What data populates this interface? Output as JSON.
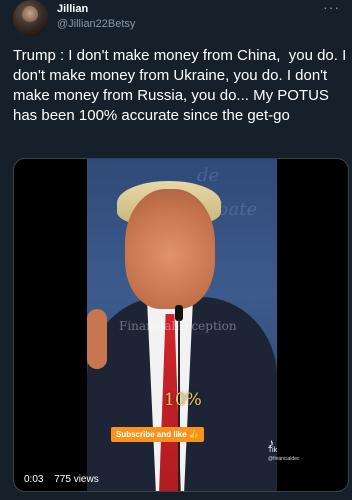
{
  "tweet": {
    "display_name": "Jillian",
    "handle": "@Jillian22Betsy",
    "more_icon": "ellipsis-icon",
    "text": "Trump : I don't make money from China,  you do. I don't make money from Ukraine, you do. I don't make money from Russia, you do... My POTUS has been 100% accurate since the get-go"
  },
  "video": {
    "watermark": "FinancialReception",
    "overlay_percent": "10%",
    "subscribe_label": "Subscribe and like 👍",
    "tiktok_label": "Tik",
    "tiktok_user": "@financialdec",
    "time": "0:03",
    "views": "775 views",
    "bg_text_1": "de",
    "bg_text_2": "bate"
  },
  "colors": {
    "background": "#15202b",
    "text_primary": "#ffffff",
    "text_secondary": "#8b98a5",
    "subscribe_bg": "#f7931e",
    "percent_color": "#f2c94c"
  }
}
